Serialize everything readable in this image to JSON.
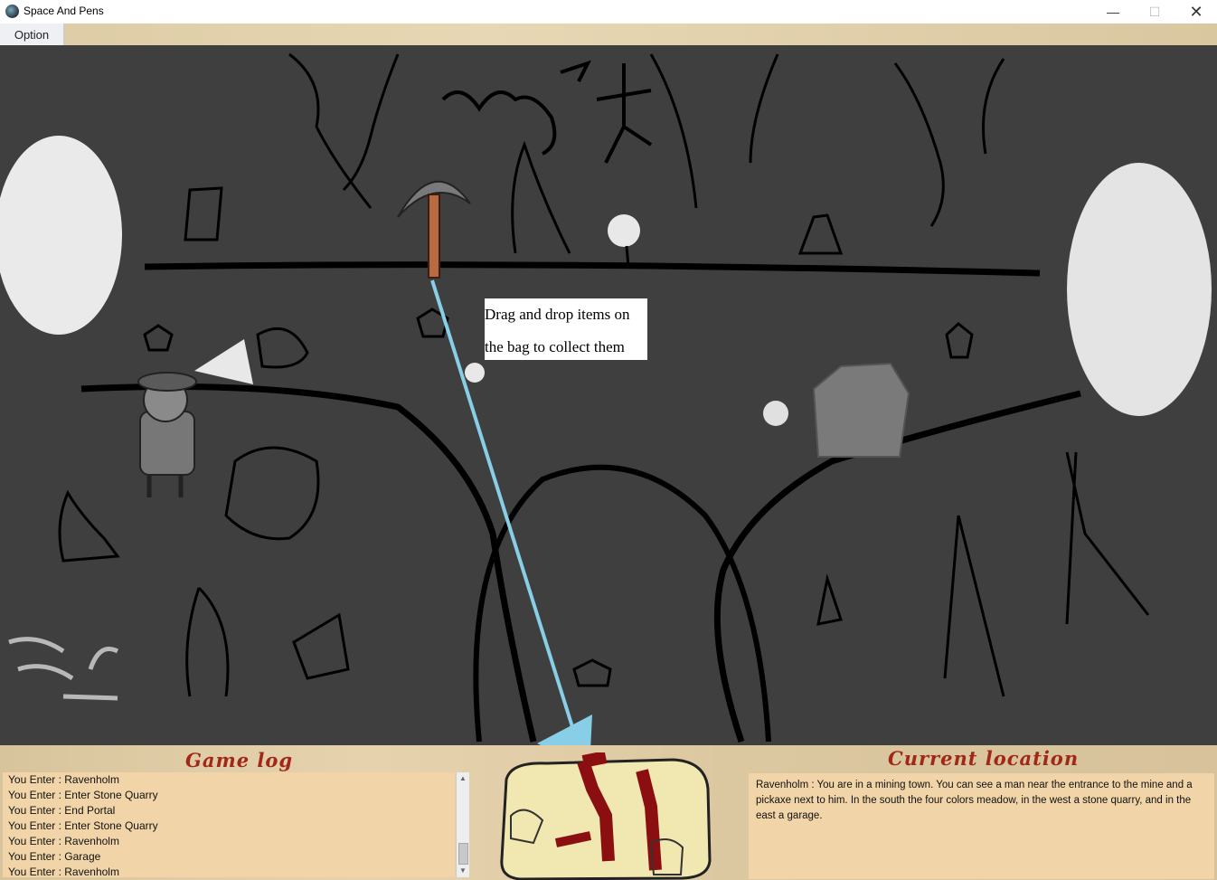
{
  "window": {
    "title": "Space And Pens",
    "min_icon": "minimize-icon",
    "max_icon": "maximize-icon",
    "close_icon": "close-icon"
  },
  "menu": {
    "option_label": "Option"
  },
  "scene": {
    "tooltip_line1": "Drag and drop items on",
    "tooltip_line2": "the bag to collect them"
  },
  "game_log": {
    "title": "Game log",
    "entries": [
      "You Enter : Ravenholm",
      "You Enter : Enter Stone Quarry",
      "You Enter : End Portal",
      "You Enter : Enter Stone Quarry",
      "You Enter : Ravenholm",
      "You Enter : Garage",
      "You Enter : Ravenholm"
    ]
  },
  "current_location": {
    "title": "Current location",
    "text": "Ravenholm : You are in a mining town. You can see a man near the entrance to the mine and a pickaxe next to him. In the south the four colors meadow, in the west a stone quarry, and in the east a garage."
  },
  "colors": {
    "scene_bg": "#3f3f3f",
    "title_red": "#a02818",
    "panel_bg": "#f1d5a8",
    "drag_arrow": "#87cee6"
  }
}
